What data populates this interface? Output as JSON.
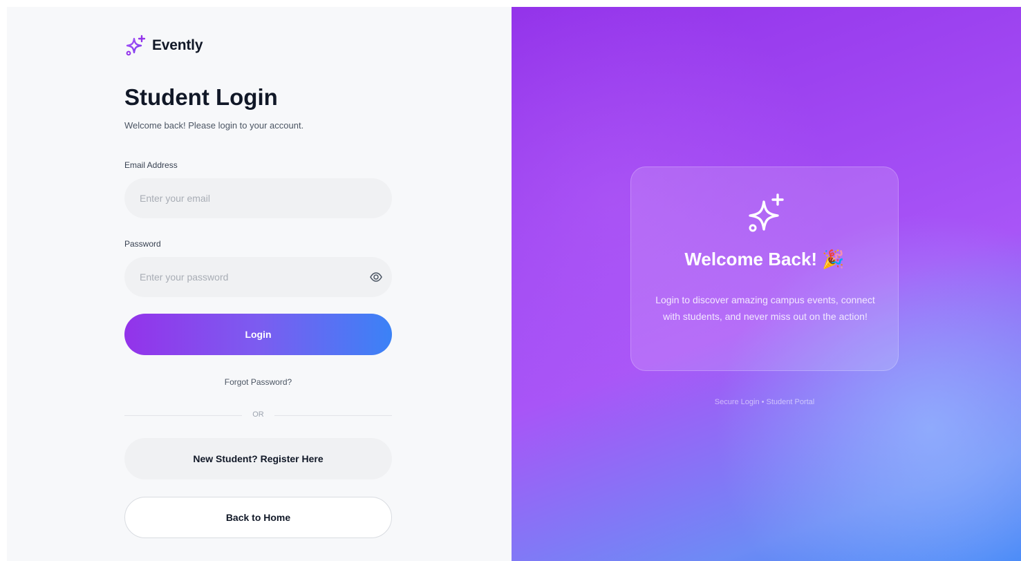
{
  "brand": {
    "name": "Evently",
    "icon": "sparkles-icon",
    "color": "#9333ea"
  },
  "login": {
    "title": "Student Login",
    "subtitle": "Welcome back! Please login to your account.",
    "email": {
      "label": "Email Address",
      "placeholder": "Enter your email",
      "value": ""
    },
    "password": {
      "label": "Password",
      "placeholder": "Enter your password",
      "value": "",
      "toggle_icon": "eye-icon"
    },
    "login_button": "Login",
    "forgot_link": "Forgot Password?",
    "divider_text": "OR",
    "register_button": "New Student? Register Here",
    "home_button": "Back to Home"
  },
  "welcome": {
    "icon": "sparkles-icon",
    "title": "Welcome Back! 🎉",
    "text": "Login to discover amazing campus events, connect with students, and never miss out on the action!",
    "footnote": "Secure Login • Student Portal"
  },
  "colors": {
    "accent_purple": "#9333ea",
    "accent_blue": "#3b82f6",
    "panel_bg": "#f7f8fa",
    "input_bg": "#f0f1f3"
  }
}
